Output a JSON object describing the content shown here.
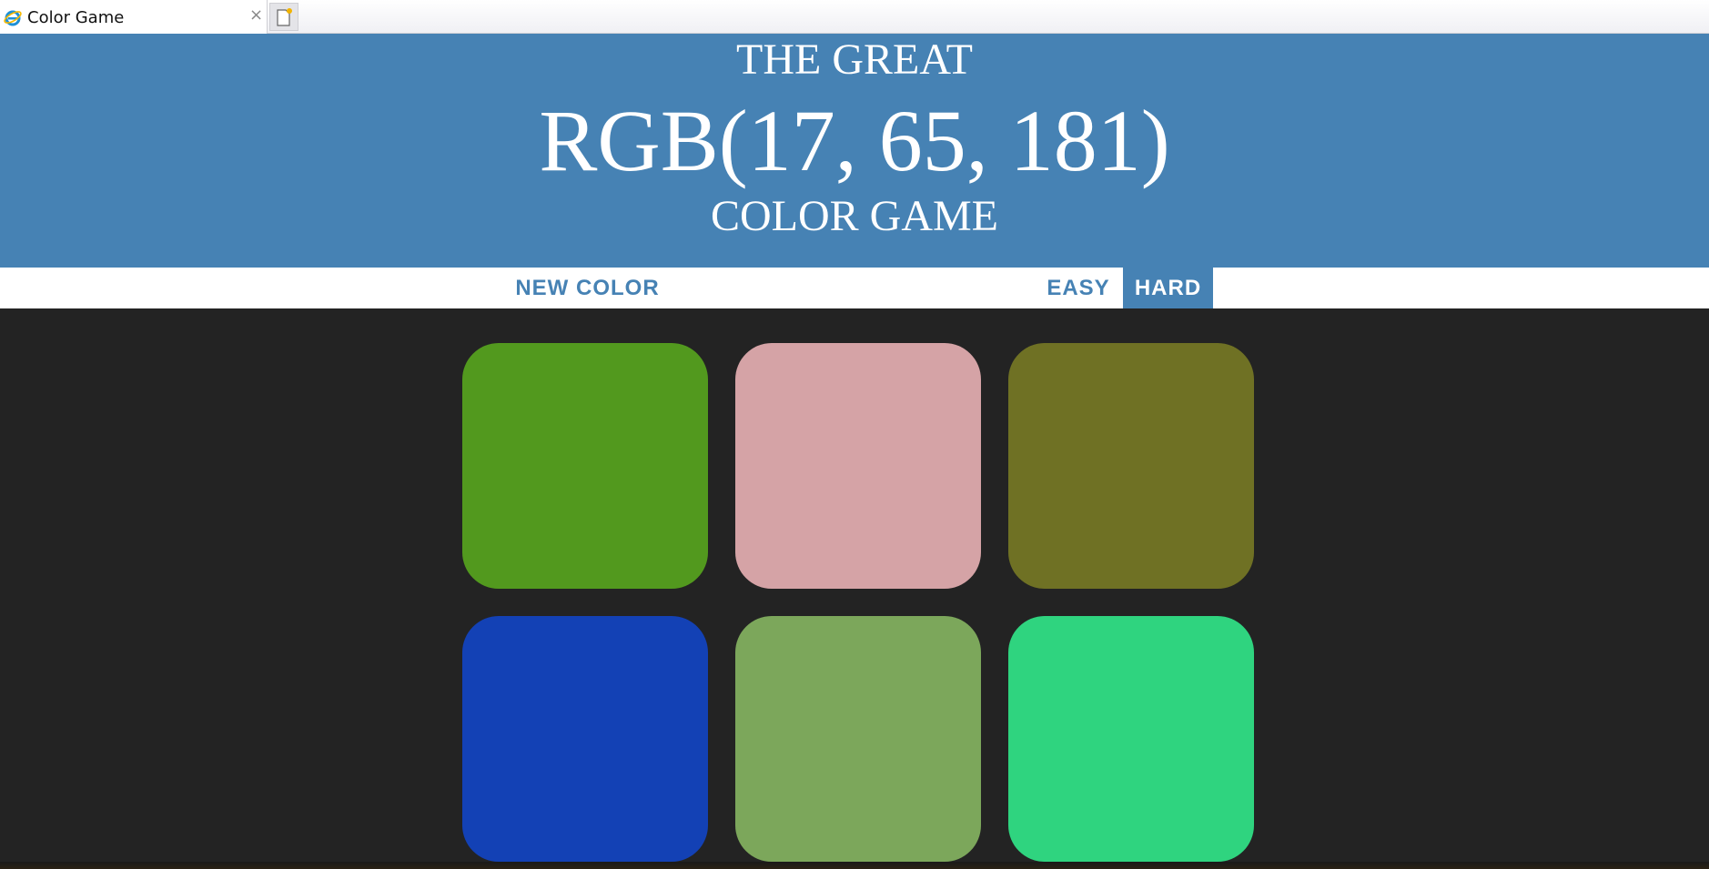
{
  "browser": {
    "tab_title": "Color Game",
    "tab_close": "×",
    "icons": {
      "tab": "ie-icon",
      "new_tab": "new-tab-icon"
    }
  },
  "header": {
    "line1": "THE GREAT",
    "color_display": "RGB(17, 65, 181)",
    "line3": "COLOR GAME",
    "background": "#4682b4"
  },
  "stripe": {
    "new_color_label": "NEW COLOR",
    "message": "",
    "easy_label": "EASY",
    "hard_label": "HARD",
    "selected_mode": "HARD"
  },
  "squares": [
    {
      "color": "#52991e"
    },
    {
      "color": "#d5a3a6"
    },
    {
      "color": "#6f7124"
    },
    {
      "color": "#1341b5"
    },
    {
      "color": "#7ca75b"
    },
    {
      "color": "#2fd47f"
    }
  ],
  "colors": {
    "page_background": "#232323",
    "accent": "#4682b4"
  }
}
